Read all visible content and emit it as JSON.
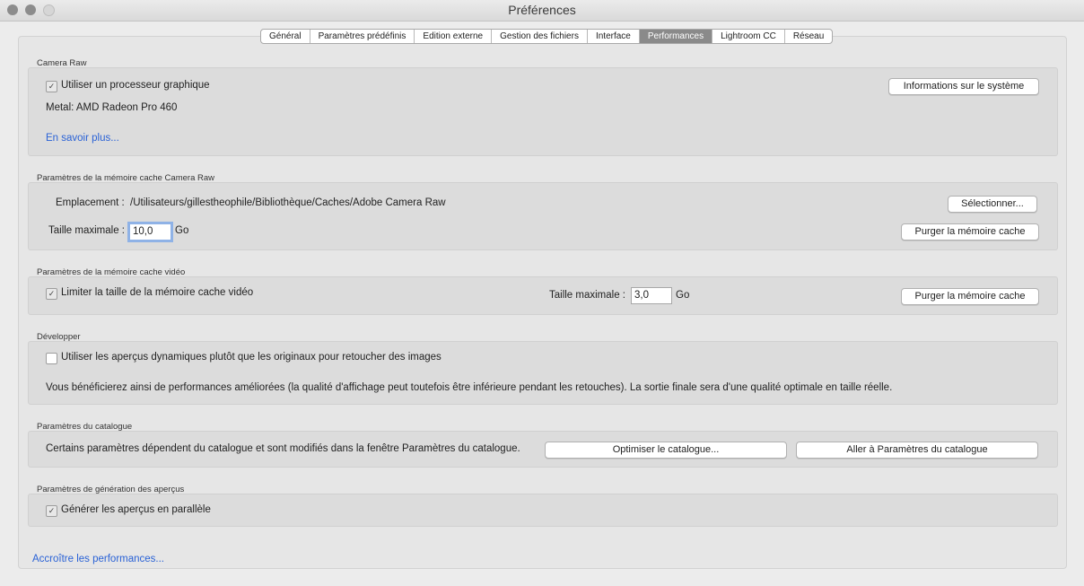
{
  "window": {
    "title": "Préférences"
  },
  "tabs": [
    {
      "label": "Général"
    },
    {
      "label": "Paramètres prédéfinis"
    },
    {
      "label": "Edition externe"
    },
    {
      "label": "Gestion des fichiers"
    },
    {
      "label": "Interface"
    },
    {
      "label": "Performances"
    },
    {
      "label": "Lightroom CC"
    },
    {
      "label": "Réseau"
    }
  ],
  "camera_raw": {
    "title": "Camera Raw",
    "gpu_label": "Utiliser un processeur graphique",
    "gpu_checked": true,
    "system_info_button": "Informations sur le système",
    "metal_text": "Metal: AMD Radeon Pro 460",
    "learn_more": "En savoir plus..."
  },
  "cache_camera_raw": {
    "title": "Paramètres de la mémoire cache Camera Raw",
    "location_label": "Emplacement :",
    "location_value": "/Utilisateurs/gillestheophile/Bibliothèque/Caches/Adobe Camera Raw",
    "select_button": "Sélectionner...",
    "max_size_label": "Taille maximale :",
    "max_size_value": "10,0",
    "unit": "Go",
    "purge_button": "Purger la mémoire cache"
  },
  "cache_video": {
    "title": "Paramètres de la mémoire cache vidéo",
    "limit_label": "Limiter la taille de la mémoire cache vidéo",
    "limit_checked": true,
    "max_size_label": "Taille maximale :",
    "max_size_value": "3,0",
    "unit": "Go",
    "purge_button": "Purger la mémoire cache"
  },
  "develop": {
    "title": "Développer",
    "smart_preview_label": "Utiliser les aperçus dynamiques plutôt que les originaux pour retoucher des images",
    "smart_preview_checked": false,
    "info_text": "Vous bénéficierez ainsi de performances améliorées (la qualité d'affichage peut toutefois être inférieure pendant les retouches). La sortie finale sera d'une qualité optimale en taille réelle."
  },
  "catalog": {
    "title": "Paramètres du catalogue",
    "info_text": "Certains paramètres dépendent du catalogue et sont modifiés dans la fenêtre Paramètres du catalogue.",
    "optimize_button": "Optimiser le catalogue...",
    "goto_button": "Aller à Paramètres du catalogue"
  },
  "previews": {
    "title": "Paramètres de génération des aperçus",
    "parallel_label": "Générer les aperçus en parallèle",
    "parallel_checked": true
  },
  "footer": {
    "boost_link": "Accroître les performances..."
  },
  "colors": {
    "link": "#2a62d6",
    "active_tab": "#8a8a8a",
    "focus_ring": "#8fb2e6"
  }
}
